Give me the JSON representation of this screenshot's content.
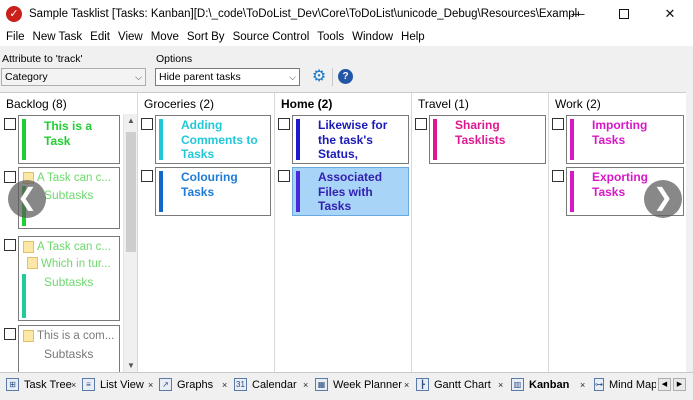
{
  "window": {
    "title": "Sample Tasklist [Tasks: Kanban][D:\\_code\\ToDoList_Dev\\Core\\ToDoList\\unicode_Debug\\Resources\\Examples\\I...",
    "app_icon_glyph": "✓",
    "minimize_glyph": "—",
    "close_glyph": "✕"
  },
  "menu": [
    "File",
    "New Task",
    "Edit",
    "View",
    "Move",
    "Sort By",
    "Source Control",
    "Tools",
    "Window",
    "Help"
  ],
  "toolbar": {
    "attribute_label": "Attribute to 'track'",
    "attribute_value": "Category",
    "options_label": "Options",
    "options_value": "Hide parent tasks",
    "dropdown_glyph": "⌵",
    "gear_glyph": "⚙",
    "help_glyph": "?"
  },
  "columns": [
    {
      "header": "Backlog (8)"
    },
    {
      "header": "Groceries (2)"
    },
    {
      "header": "Home (2)"
    },
    {
      "header": "Travel (1)"
    },
    {
      "header": "Work (2)"
    }
  ],
  "cards": {
    "backlog_1": {
      "title": "This is a\nTask",
      "color": "#22cc33"
    },
    "backlog_2": {
      "title": "A Task can c...",
      "sub": "Subtasks",
      "color": "#22cc33",
      "title_color": "#6dd86d"
    },
    "backlog_3": {
      "title": "A Task can c...",
      "sub1": "Which in tur...",
      "sub2": "Subtasks",
      "color": "#22cc99",
      "title_color": "#6dd86d"
    },
    "backlog_4": {
      "title": "This is a com...",
      "sub": "Subtasks",
      "title_color": "#7a7a7a"
    },
    "groceries_1": {
      "title": "Adding\nComments to\nTasks",
      "color": "#22c8d8"
    },
    "groceries_2": {
      "title": "Colouring\nTasks",
      "color": "#1466c8",
      "title_color": "#1e7bd8"
    },
    "home_1": {
      "title": "Likewise for\nthe task's\nStatus,",
      "color": "#1a1ad0",
      "title_color": "#1a1ab8"
    },
    "home_2": {
      "title": "Associated\nFiles with\nTasks",
      "color": "#4a2ad8",
      "title_color": "#3320b0"
    },
    "travel_1": {
      "title": "Sharing\nTasklists",
      "color": "#e01890"
    },
    "work_1": {
      "title": "Importing\nTasks",
      "color": "#d818c8"
    },
    "work_2": {
      "title": "Exporting\nTasks",
      "color": "#d818c8"
    }
  },
  "nav": {
    "prev_glyph": "❮",
    "next_glyph": "❯"
  },
  "scroll": {
    "up_glyph": "▲",
    "down_glyph": "▼"
  },
  "tabs": [
    {
      "label": "Task Tree",
      "icon": "tree-icon",
      "glyph": "⊞"
    },
    {
      "label": "List View",
      "icon": "list-icon",
      "glyph": "≡"
    },
    {
      "label": "Graphs",
      "icon": "graph-icon",
      "glyph": "↗"
    },
    {
      "label": "Calendar",
      "icon": "calendar-icon",
      "glyph": "31"
    },
    {
      "label": "Week Planner",
      "icon": "week-planner-icon",
      "glyph": "▦"
    },
    {
      "label": "Gantt Chart",
      "icon": "gantt-icon",
      "glyph": "┣"
    },
    {
      "label": "Kanban",
      "icon": "kanban-icon",
      "glyph": "▥"
    },
    {
      "label": "Mind Map",
      "icon": "mind-map-icon",
      "glyph": "⊶"
    }
  ],
  "tab_close_glyph": "×",
  "tab_scroll": {
    "left_glyph": "◀",
    "right_glyph": "▶"
  }
}
